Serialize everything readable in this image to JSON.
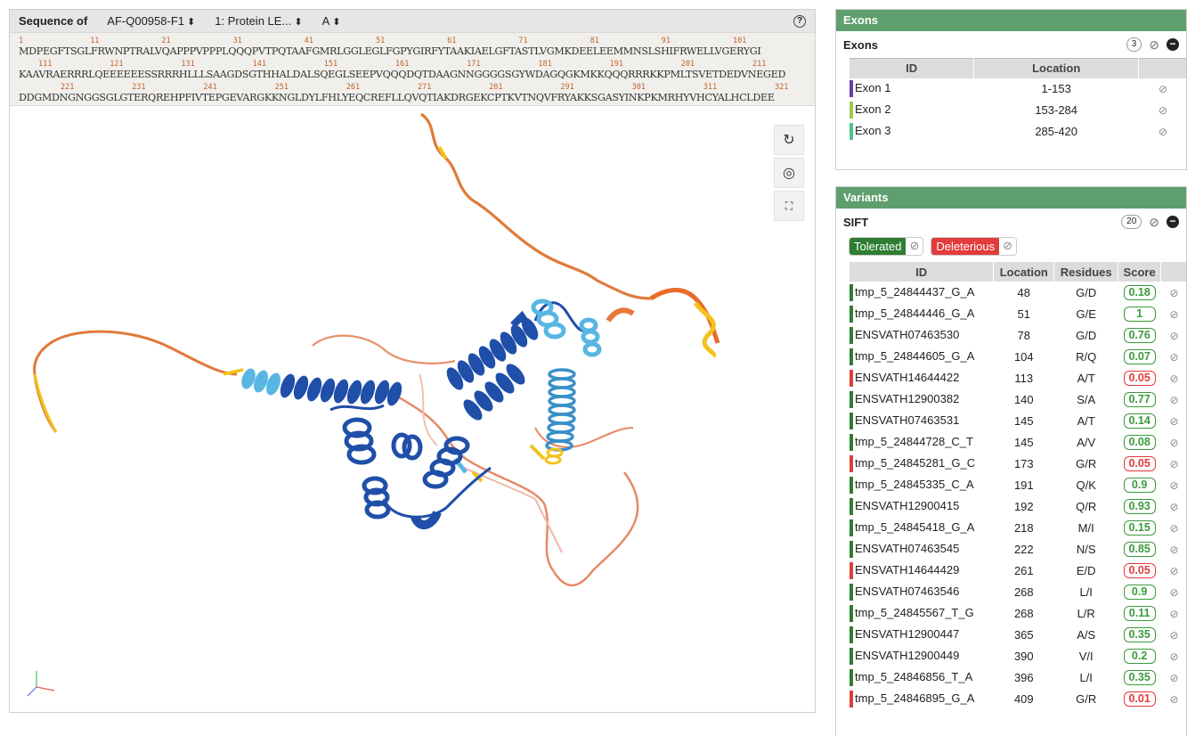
{
  "viewer": {
    "sequence_label": "Sequence of",
    "entry_select": "AF-Q00958-F1",
    "entity_select": "1: Protein LE...",
    "chain_select": "A",
    "help_icon": "help-icon",
    "sequence_rows": [
      {
        "numbers": [
          "1",
          "11",
          "21",
          "31",
          "41",
          "51",
          "61",
          "71",
          "81",
          "91",
          "101"
        ],
        "residues": "MDPEGFTSGLFRWNPTRALVQAPPPVPPPLQQQPVTPQTAAFGMRLGGLEGLFGPYGIRFYTAAKIAELGFTASTLVGMKDEELEEMMNSLSHIFRWELLVGERYGI"
      },
      {
        "numbers": [
          "111",
          "121",
          "131",
          "141",
          "151",
          "161",
          "171",
          "181",
          "191",
          "201",
          "211"
        ],
        "residues": "KAAVRAERRRLQEEEEEESSRRRHLLLSAAGDSGTHHALDALSQEGLSEEPVQQQDQTDAAGNNGGGGSGYWDAGQGKMKKQQQRRRKKPMLTSVETDEDVNEGED"
      },
      {
        "numbers": [
          "221",
          "231",
          "241",
          "251",
          "261",
          "271",
          "281",
          "291",
          "301",
          "311",
          "321"
        ],
        "residues": "DDGMDNGNGGSGLGTERQREHPFIVTEPGEVARGKKNGLDYLFHLYEQCREFLLQVQTIAKDRGEKCPTKVTNQVFRYAKKSGASYINKPKMRHYVHCYALHCLDEE"
      }
    ],
    "tools": [
      "reset-icon",
      "screenshot-icon",
      "expand-icon"
    ]
  },
  "exons_panel": {
    "title": "Exons",
    "track_title": "Exons",
    "count": "3",
    "columns": [
      "ID",
      "Location",
      ""
    ],
    "rows": [
      {
        "id": "Exon 1",
        "location": "1-153",
        "color": "#6b3fa8"
      },
      {
        "id": "Exon 2",
        "location": "153-284",
        "color": "#9ccc4a"
      },
      {
        "id": "Exon 3",
        "location": "285-420",
        "color": "#4fc38a"
      }
    ]
  },
  "variants_panel": {
    "title": "Variants",
    "track_title": "SIFT",
    "count": "20",
    "filter_tolerated": "Tolerated",
    "filter_deleterious": "Deleterious",
    "columns": [
      "ID",
      "Location",
      "Residues",
      "Score",
      ""
    ],
    "rows": [
      {
        "id": "tmp_5_24844437_G_A",
        "location": "48",
        "residues": "G/D",
        "score": "0.18",
        "status": "tolerated"
      },
      {
        "id": "tmp_5_24844446_G_A",
        "location": "51",
        "residues": "G/E",
        "score": "1",
        "status": "tolerated"
      },
      {
        "id": "ENSVATH07463530",
        "location": "78",
        "residues": "G/D",
        "score": "0.76",
        "status": "tolerated"
      },
      {
        "id": "tmp_5_24844605_G_A",
        "location": "104",
        "residues": "R/Q",
        "score": "0.07",
        "status": "tolerated"
      },
      {
        "id": "ENSVATH14644422",
        "location": "113",
        "residues": "A/T",
        "score": "0.05",
        "status": "deleterious"
      },
      {
        "id": "ENSVATH12900382",
        "location": "140",
        "residues": "S/A",
        "score": "0.77",
        "status": "tolerated"
      },
      {
        "id": "ENSVATH07463531",
        "location": "145",
        "residues": "A/T",
        "score": "0.14",
        "status": "tolerated"
      },
      {
        "id": "tmp_5_24844728_C_T",
        "location": "145",
        "residues": "A/V",
        "score": "0.08",
        "status": "tolerated"
      },
      {
        "id": "tmp_5_24845281_G_C",
        "location": "173",
        "residues": "G/R",
        "score": "0.05",
        "status": "deleterious"
      },
      {
        "id": "tmp_5_24845335_C_A",
        "location": "191",
        "residues": "Q/K",
        "score": "0.9",
        "status": "tolerated"
      },
      {
        "id": "ENSVATH12900415",
        "location": "192",
        "residues": "Q/R",
        "score": "0.93",
        "status": "tolerated"
      },
      {
        "id": "tmp_5_24845418_G_A",
        "location": "218",
        "residues": "M/I",
        "score": "0.15",
        "status": "tolerated"
      },
      {
        "id": "ENSVATH07463545",
        "location": "222",
        "residues": "N/S",
        "score": "0.85",
        "status": "tolerated"
      },
      {
        "id": "ENSVATH14644429",
        "location": "261",
        "residues": "E/D",
        "score": "0.05",
        "status": "deleterious"
      },
      {
        "id": "ENSVATH07463546",
        "location": "268",
        "residues": "L/I",
        "score": "0.9",
        "status": "tolerated"
      },
      {
        "id": "tmp_5_24845567_T_G",
        "location": "268",
        "residues": "L/R",
        "score": "0.11",
        "status": "tolerated"
      },
      {
        "id": "ENSVATH12900447",
        "location": "365",
        "residues": "A/S",
        "score": "0.35",
        "status": "tolerated"
      },
      {
        "id": "ENSVATH12900449",
        "location": "390",
        "residues": "V/I",
        "score": "0.2",
        "status": "tolerated"
      },
      {
        "id": "tmp_5_24846856_T_A",
        "location": "396",
        "residues": "L/I",
        "score": "0.35",
        "status": "tolerated"
      },
      {
        "id": "tmp_5_24846895_G_A",
        "location": "409",
        "residues": "G/R",
        "score": "0.01",
        "status": "deleterious"
      }
    ]
  },
  "colors": {
    "panel_header": "#5f9f6e",
    "tolerated": "#2e7d32",
    "deleterious": "#e23b3b",
    "helix_dark": "#1f4fa8",
    "helix_light": "#58b6e3",
    "coil_orange": "#e8793a",
    "coil_yellow": "#f2c21b"
  }
}
